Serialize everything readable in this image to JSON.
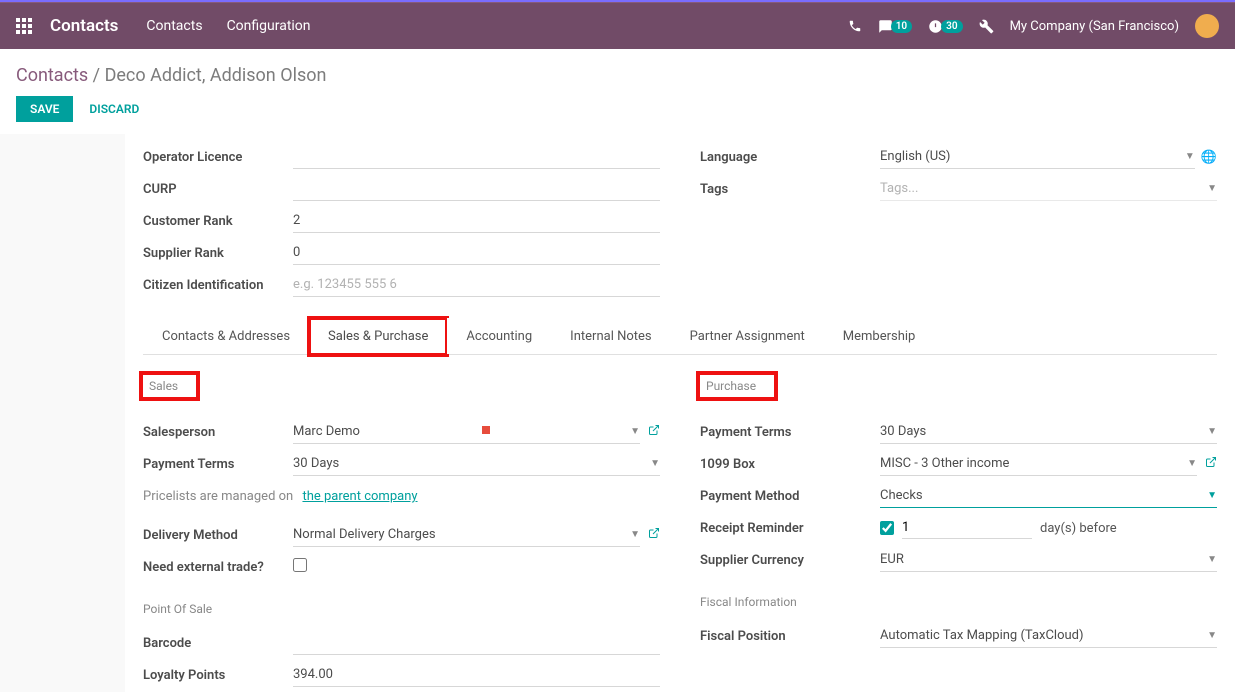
{
  "navbar": {
    "brand": "Contacts",
    "links": [
      "Contacts",
      "Configuration"
    ],
    "msg_badge": "10",
    "activity_badge": "30",
    "company": "My Company (San Francisco)"
  },
  "breadcrumb": {
    "root": "Contacts",
    "current": "Deco Addict, Addison Olson"
  },
  "actions": {
    "save": "SAVE",
    "discard": "DISCARD"
  },
  "top_left": {
    "operator_licence_label": "Operator Licence",
    "curp_label": "CURP",
    "customer_rank_label": "Customer Rank",
    "customer_rank": "2",
    "supplier_rank_label": "Supplier Rank",
    "supplier_rank": "0",
    "citizen_id_label": "Citizen Identification",
    "citizen_id_placeholder": "e.g. 123455 555 6"
  },
  "top_right": {
    "language_label": "Language",
    "language": "English (US)",
    "tags_label": "Tags",
    "tags_placeholder": "Tags..."
  },
  "tabs": [
    "Contacts & Addresses",
    "Sales & Purchase",
    "Accounting",
    "Internal Notes",
    "Partner Assignment",
    "Membership"
  ],
  "sales": {
    "header": "Sales",
    "salesperson_label": "Salesperson",
    "salesperson": "Marc Demo",
    "payment_terms_label": "Payment Terms",
    "payment_terms": "30 Days",
    "pricelist_info_prefix": "Pricelists are managed on",
    "pricelist_link": "the parent company",
    "delivery_method_label": "Delivery Method",
    "delivery_method": "Normal Delivery Charges",
    "external_trade_label": "Need external trade?",
    "pos_header": "Point Of Sale",
    "barcode_label": "Barcode",
    "loyalty_label": "Loyalty Points",
    "loyalty": "394.00"
  },
  "purchase": {
    "header": "Purchase",
    "payment_terms_label": "Payment Terms",
    "payment_terms": "30 Days",
    "box1099_label": "1099 Box",
    "box1099": "MISC - 3 Other income",
    "payment_method_label": "Payment Method",
    "payment_method": "Checks",
    "receipt_reminder_label": "Receipt Reminder",
    "receipt_reminder_days": "1",
    "receipt_reminder_suffix": "day(s) before",
    "supplier_currency_label": "Supplier Currency",
    "supplier_currency": "EUR",
    "fiscal_header": "Fiscal Information",
    "fiscal_position_label": "Fiscal Position",
    "fiscal_position": "Automatic Tax Mapping (TaxCloud)"
  }
}
